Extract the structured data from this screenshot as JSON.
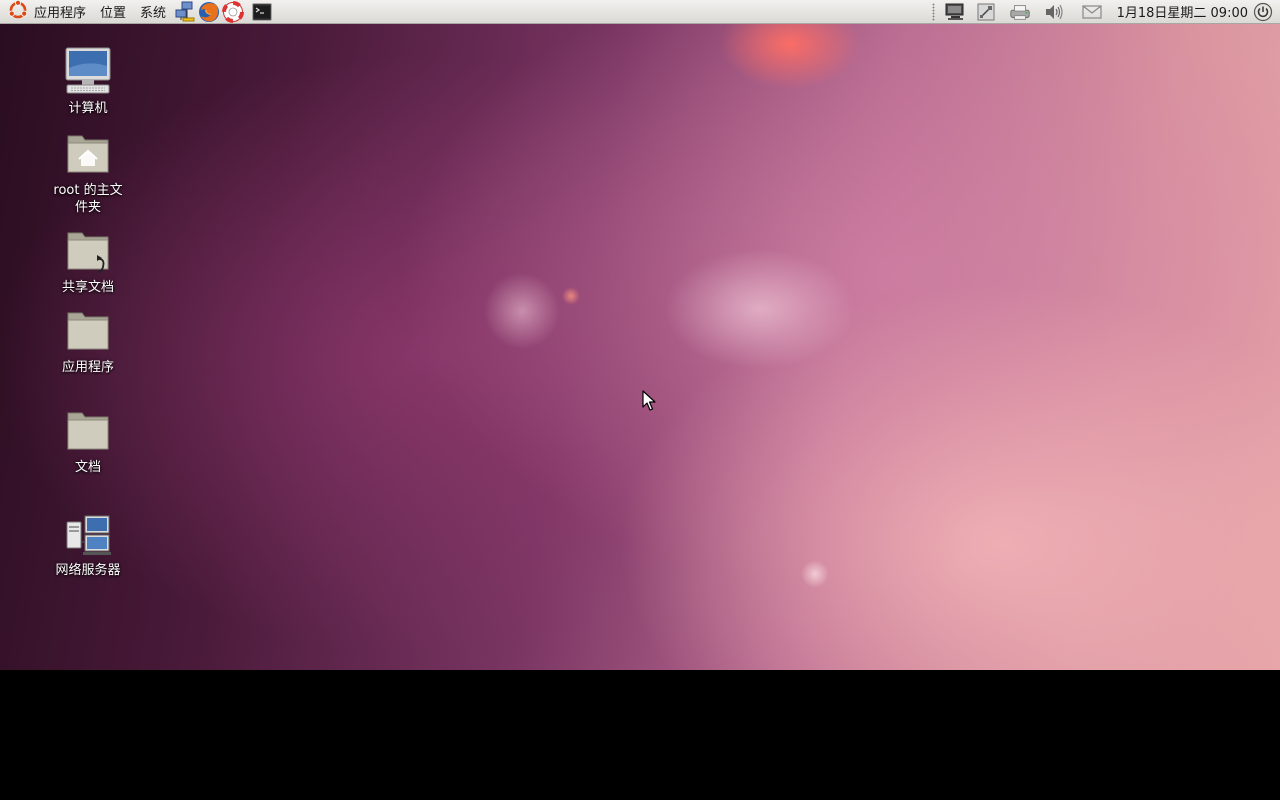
{
  "top_panel": {
    "menus": {
      "applications": "应用程序",
      "places": "位置",
      "system": "系统"
    },
    "launchers": [
      "network-servers-icon",
      "firefox-icon",
      "help-icon",
      "terminal-icon"
    ],
    "tray": [
      "network-display-icon",
      "network-wired-icon",
      "printer-icon",
      "volume-icon",
      "mail-icon"
    ],
    "clock": "1月18日星期二 09:00",
    "session_icon": "power-icon"
  },
  "desktop": {
    "icons": [
      {
        "label": "计算机",
        "icon": "computer-icon"
      },
      {
        "label": "root 的主文件夹",
        "icon": "home-folder-icon"
      },
      {
        "label": "共享文档",
        "icon": "shared-folder-icon"
      },
      {
        "label": "应用程序",
        "icon": "folder-icon"
      },
      {
        "label": "文档",
        "icon": "folder-icon"
      },
      {
        "label": "网络服务器",
        "icon": "network-servers-icon"
      }
    ]
  },
  "colors": {
    "panel_bg": "#dcdad5",
    "ubuntu_orange": "#dd4814",
    "folder": "#c9c6b8"
  }
}
